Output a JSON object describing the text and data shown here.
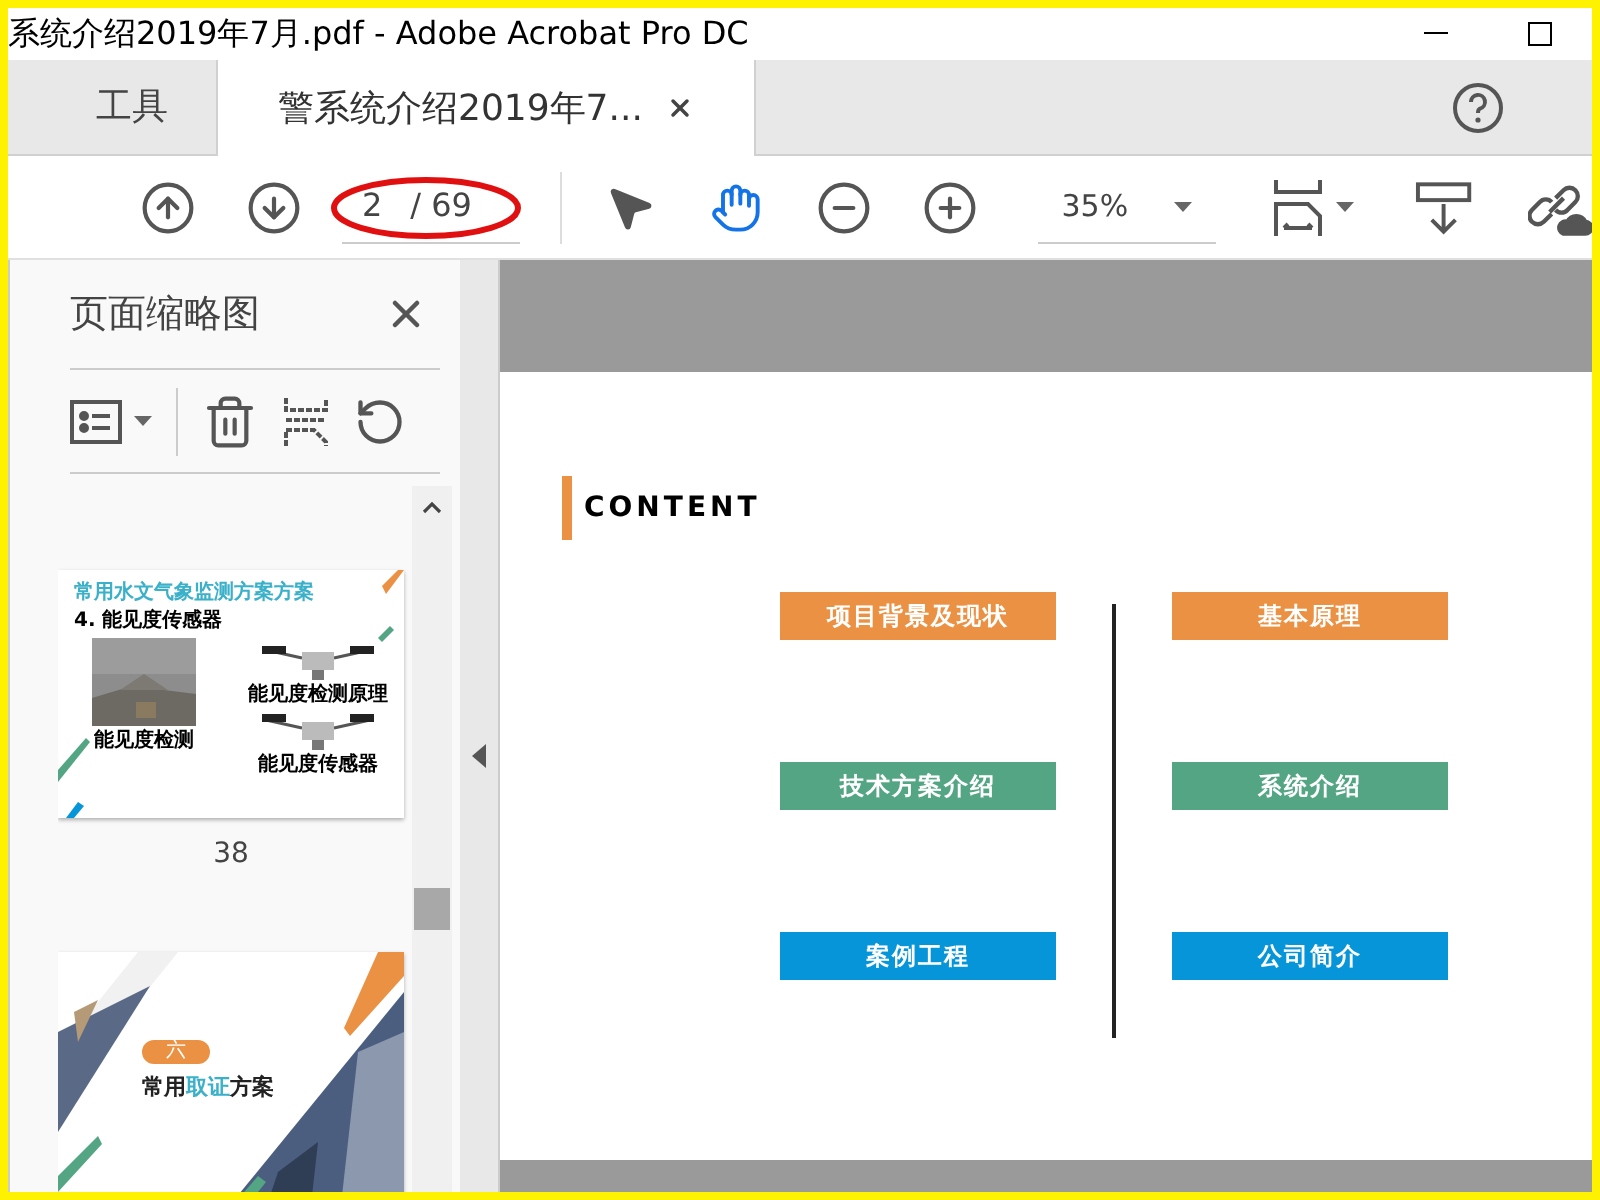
{
  "window": {
    "title": "系统介绍2019年7月.pdf - Adobe Acrobat Pro DC"
  },
  "tabs": [
    {
      "label": "工具",
      "selected": false,
      "closable": false
    },
    {
      "label": "警系统介绍2019年7...",
      "selected": true,
      "closable": true
    }
  ],
  "toolbar": {
    "page_field": {
      "value": "2",
      "total": "/ 69",
      "circled": true
    },
    "tools": [
      {
        "kind": "select",
        "selected": false
      },
      {
        "kind": "hand",
        "selected": true
      }
    ],
    "zoom": {
      "value": "35%"
    }
  },
  "sidebar": {
    "title": "页面缩略图",
    "thumbnails": [
      {
        "kind": "sensor",
        "title": "常用水文气象监测方案方案",
        "subtitle": "4. 能见度传感器",
        "captions": [
          "能见度检测",
          "能见度检测原理",
          "能见度传感器"
        ],
        "page_label": "38"
      },
      {
        "kind": "cover",
        "badge": "六",
        "title_parts": [
          {
            "text": "常用",
            "highlight": false
          },
          {
            "text": "取证",
            "highlight": true
          },
          {
            "text": "方案",
            "highlight": false
          }
        ]
      }
    ]
  },
  "document": {
    "heading": "CONTENT",
    "items": [
      {
        "label": "项目背景及现状",
        "color": "#eb9144"
      },
      {
        "label": "技术方案介绍",
        "color": "#53a583"
      },
      {
        "label": "案例工程",
        "color": "#0595d8"
      },
      {
        "label": "基本原理",
        "color": "#eb9144"
      },
      {
        "label": "系统介绍",
        "color": "#53a583"
      },
      {
        "label": "公司简介",
        "color": "#0595d8"
      }
    ]
  }
}
